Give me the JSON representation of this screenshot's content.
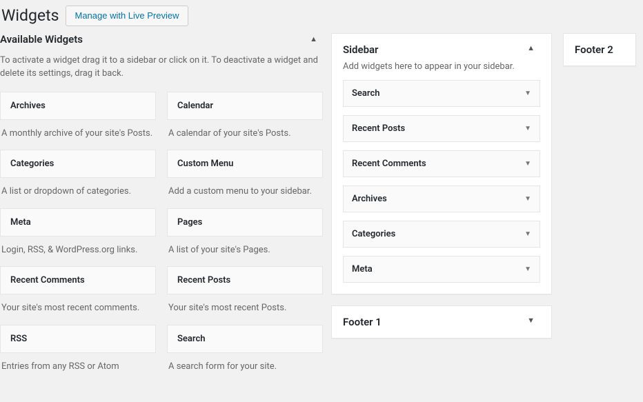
{
  "header": {
    "title": "Widgets",
    "live_preview_label": "Manage with Live Preview"
  },
  "available": {
    "section_title": "Available Widgets",
    "description": "To activate a widget drag it to a sidebar or click on it. To deactivate a widget and delete its settings, drag it back.",
    "widgets": [
      {
        "title": "Archives",
        "desc": "A monthly archive of your site's Posts."
      },
      {
        "title": "Calendar",
        "desc": "A calendar of your site's Posts."
      },
      {
        "title": "Categories",
        "desc": "A list or dropdown of categories."
      },
      {
        "title": "Custom Menu",
        "desc": "Add a custom menu to your sidebar."
      },
      {
        "title": "Meta",
        "desc": "Login, RSS, & WordPress.org links."
      },
      {
        "title": "Pages",
        "desc": "A list of your site's Pages."
      },
      {
        "title": "Recent Comments",
        "desc": "Your site's most recent comments."
      },
      {
        "title": "Recent Posts",
        "desc": "Your site's most recent Posts."
      },
      {
        "title": "RSS",
        "desc": "Entries from any RSS or Atom"
      },
      {
        "title": "Search",
        "desc": "A search form for your site."
      }
    ]
  },
  "areas": {
    "sidebar": {
      "title": "Sidebar",
      "desc": "Add widgets here to appear in your sidebar.",
      "widgets": [
        "Search",
        "Recent Posts",
        "Recent Comments",
        "Archives",
        "Categories",
        "Meta"
      ]
    },
    "footer1": {
      "title": "Footer 1"
    },
    "footer2": {
      "title": "Footer 2"
    }
  },
  "icons": {
    "collapse_up": "▲",
    "expand_down": "▼"
  }
}
